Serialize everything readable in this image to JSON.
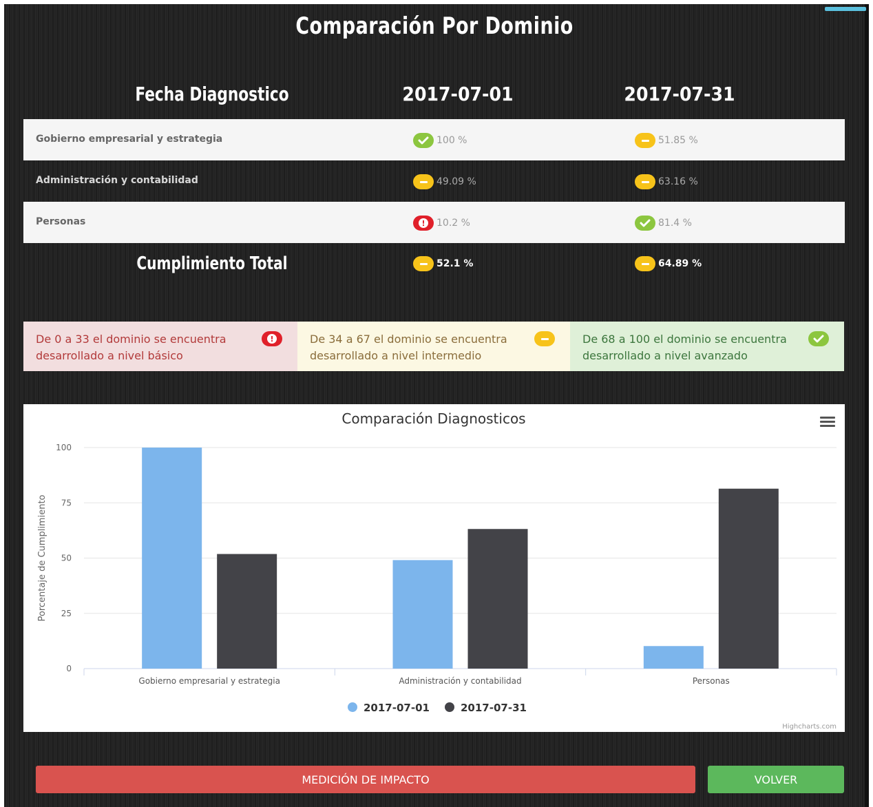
{
  "page": {
    "title": "Comparación Por Dominio"
  },
  "table": {
    "header_label": "Fecha Diagnostico",
    "dates": [
      "2017-07-01",
      "2017-07-31"
    ],
    "rows": [
      {
        "label": "Gobierno empresarial y estrategia",
        "values": [
          "100 %",
          "51.85 %"
        ],
        "status": [
          "ok",
          "mid"
        ]
      },
      {
        "label": "Administración y contabilidad",
        "values": [
          "49.09 %",
          "63.16 %"
        ],
        "status": [
          "mid",
          "mid"
        ]
      },
      {
        "label": "Personas",
        "values": [
          "10.2 %",
          "81.4 %"
        ],
        "status": [
          "bad",
          "ok"
        ]
      }
    ],
    "total": {
      "label": "Cumplimiento Total",
      "values": [
        "52.1 %",
        "64.89 %"
      ],
      "status": [
        "mid",
        "mid"
      ]
    }
  },
  "legend": {
    "basic": "De 0 a 33 el dominio se encuentra desarrollado a nivel básico",
    "intermediate": "De 34 a 67 el dominio se encuentra desarrollado a nivel intermedio",
    "advanced": "De 68 a 100 el dominio se encuentra desarrollado a nivel avanzado"
  },
  "colors": {
    "ok": "#8cc63f",
    "mid": "#f7c31a",
    "bad": "#e0202a",
    "series1": "#7cb5ec",
    "series2": "#434348"
  },
  "icons": {
    "ok": "check-icon",
    "mid": "minus-icon",
    "bad": "exclamation-icon",
    "menu": "hamburger-menu-icon"
  },
  "chart_data": {
    "type": "bar",
    "title": "Comparación Diagnosticos",
    "ylabel": "Porcentaje de Cumplimiento",
    "xlabel": "",
    "categories": [
      "Gobierno empresarial y estrategia",
      "Administración y contabilidad",
      "Personas"
    ],
    "series": [
      {
        "name": "2017-07-01",
        "values": [
          100,
          49.09,
          10.2
        ]
      },
      {
        "name": "2017-07-31",
        "values": [
          51.85,
          63.16,
          81.4
        ]
      }
    ],
    "ylim": [
      0,
      100
    ],
    "yticks": [
      0,
      25,
      50,
      75,
      100
    ],
    "grid": true,
    "legend_position": "bottom-center",
    "credits": "Highcharts.com"
  },
  "buttons": {
    "impact": "MEDICIÓN DE IMPACTO",
    "back": "VOLVER"
  }
}
